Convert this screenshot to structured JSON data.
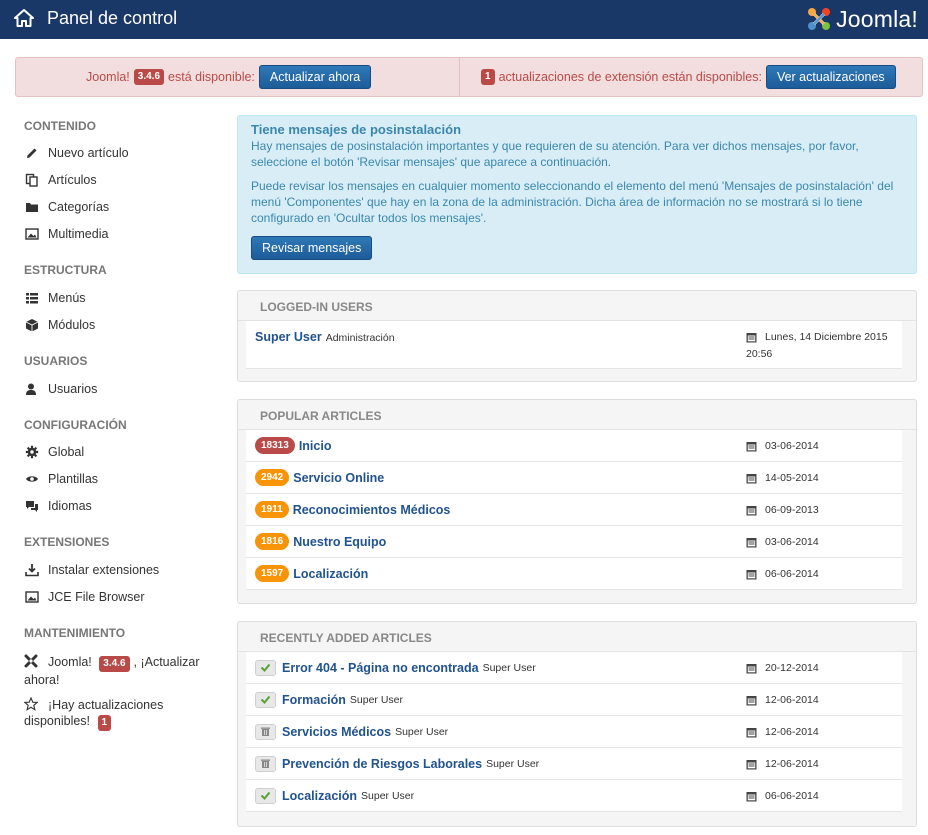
{
  "header": {
    "title": "Panel de control",
    "brand": "Joomla!"
  },
  "alerts": {
    "joomla_prefix": "Joomla!",
    "joomla_version": "3.4.6",
    "joomla_suffix": "está disponible:",
    "update_button": "Actualizar ahora",
    "ext_count": "1",
    "ext_text": "actualizaciones de extensión están disponibles:",
    "ext_button": "Ver actualizaciones"
  },
  "sidebar": {
    "contenido": "CONTENIDO",
    "nuevo_articulo": "Nuevo artículo",
    "articulos": "Artículos",
    "categorias": "Categorías",
    "multimedia": "Multimedia",
    "estructura": "ESTRUCTURA",
    "menus": "Menús",
    "modulos": "Módulos",
    "usuarios_head": "USUARIOS",
    "usuarios": "Usuarios",
    "configuracion": "CONFIGURACIÓN",
    "global": "Global",
    "plantillas": "Plantillas",
    "idiomas": "Idiomas",
    "extensiones": "EXTENSIONES",
    "instalar": "Instalar extensiones",
    "jce": "JCE File Browser",
    "mantenimiento": "MANTENIMIENTO",
    "maint_joomla": "Joomla!",
    "maint_version": "3.4.6",
    "maint_update": ", ¡Actualizar ahora!",
    "maint_hay": "¡Hay actualizaciones disponibles!",
    "maint_count": "1"
  },
  "postinstall": {
    "title": "Tiene mensajes de posinstalación",
    "p1": "Hay mensajes de posinstalación importantes y que requieren de su atención. Para ver dichos mensajes, por favor, seleccione el botón 'Revisar mensajes' que aparece a continuación.",
    "p2": "Puede revisar los mensajes en cualquier momento seleccionando el elemento del menú 'Mensajes de posinstalación' del menú 'Componentes' que hay en la zona de la administración. Dicha área de información no se mostrará si lo tiene configurado en 'Ocultar todos los mensajes'.",
    "button": "Revisar mensajes"
  },
  "logged_in": {
    "title": "LOGGED-IN USERS",
    "user": "Super User",
    "area": "Administración",
    "date_line1": "Lunes, 14 Diciembre 2015",
    "date_line2": "20:56"
  },
  "popular": {
    "title": "POPULAR ARTICLES",
    "rows": [
      {
        "hits": "18313",
        "title": "Inicio",
        "date": "03-06-2014",
        "color": "#b94a48"
      },
      {
        "hits": "2942",
        "title": "Servicio Online",
        "date": "14-05-2014",
        "color": "#f89406"
      },
      {
        "hits": "1911",
        "title": "Reconocimientos Médicos",
        "date": "06-09-2013",
        "color": "#f89406"
      },
      {
        "hits": "1816",
        "title": "Nuestro Equipo",
        "date": "03-06-2014",
        "color": "#f89406"
      },
      {
        "hits": "1597",
        "title": "Localización",
        "date": "06-06-2014",
        "color": "#f89406"
      }
    ]
  },
  "recent": {
    "title": "RECENTLY ADDED ARTICLES",
    "rows": [
      {
        "state": "check-icon",
        "title": "Error 404 - Página no encontrada",
        "author": "Super User",
        "date": "20-12-2014"
      },
      {
        "state": "check-icon",
        "title": "Formación",
        "author": "Super User",
        "date": "12-06-2014"
      },
      {
        "state": "trash-icon",
        "title": "Servicios Médicos",
        "author": "Super User",
        "date": "12-06-2014"
      },
      {
        "state": "trash-icon",
        "title": "Prevención de Riesgos Laborales",
        "author": "Super User",
        "date": "12-06-2014"
      },
      {
        "state": "check-icon",
        "title": "Localización",
        "author": "Super User",
        "date": "06-06-2014"
      }
    ]
  }
}
